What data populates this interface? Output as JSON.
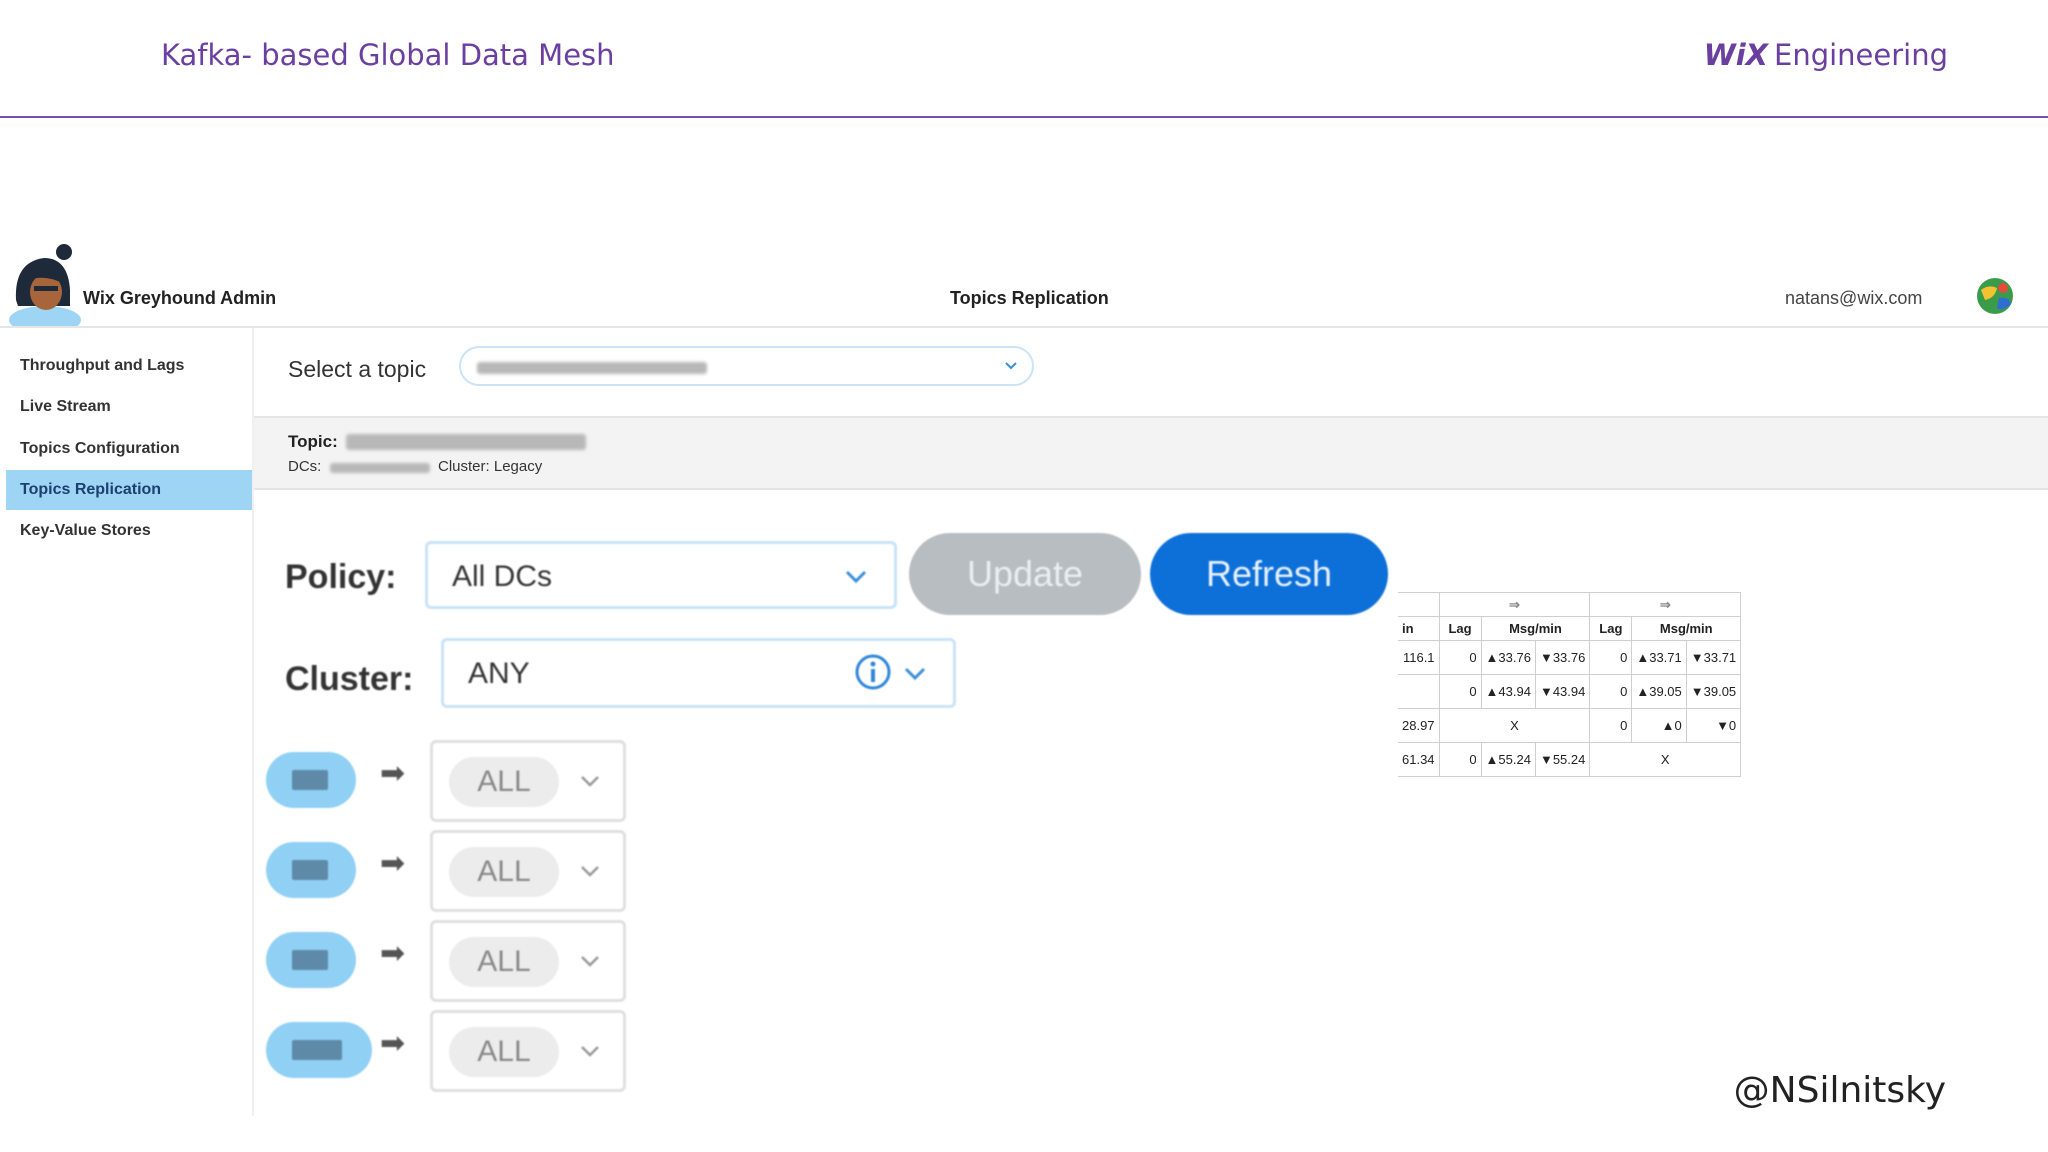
{
  "slide": {
    "title": "Kafka- based Global Data Mesh",
    "brand_logo": "WiX",
    "brand_text": "Engineering",
    "handle": "@NSilnitsky",
    "accent_color": "#6b3fa0"
  },
  "app": {
    "name": "Wix Greyhound Admin",
    "page_title": "Topics Replication",
    "user_email": "natans@wix.com"
  },
  "sidebar": {
    "items": [
      {
        "label": "Throughput and Lags"
      },
      {
        "label": "Live Stream"
      },
      {
        "label": "Topics Configuration"
      },
      {
        "label": "Topics Replication",
        "active": true
      },
      {
        "label": "Key-Value Stores"
      }
    ]
  },
  "topic_bar": {
    "select_label": "Select a topic"
  },
  "topic_info": {
    "topic_label": "Topic:",
    "dcs_label": "DCs:",
    "cluster_text": "Cluster: Legacy"
  },
  "policy": {
    "label": "Policy:",
    "value": "All DCs",
    "update_label": "Update",
    "refresh_label": "Refresh"
  },
  "cluster": {
    "label": "Cluster:",
    "value": "ANY"
  },
  "dc_rows": [
    {
      "arrow": "➡",
      "value": "ALL"
    },
    {
      "arrow": "➡",
      "value": "ALL"
    },
    {
      "arrow": "➡",
      "value": "ALL"
    },
    {
      "arrow": "➡",
      "value": "ALL"
    }
  ],
  "table": {
    "group_headers": [
      "⇒",
      "⇒"
    ],
    "headers": [
      "in",
      "Lag",
      "Msg/min",
      "Lag",
      "Msg/min"
    ],
    "rows": [
      [
        "116.1",
        "0",
        "▲33.76",
        "▼33.76",
        "0",
        "▲33.71",
        "▼33.71"
      ],
      [
        "",
        "0",
        "▲43.94",
        "▼43.94",
        "0",
        "▲39.05",
        "▼39.05"
      ],
      [
        "28.97",
        "X",
        "0",
        "▲0",
        "▼0"
      ],
      [
        "61.34",
        "0",
        "▲55.24",
        "▼55.24",
        "X"
      ]
    ]
  }
}
